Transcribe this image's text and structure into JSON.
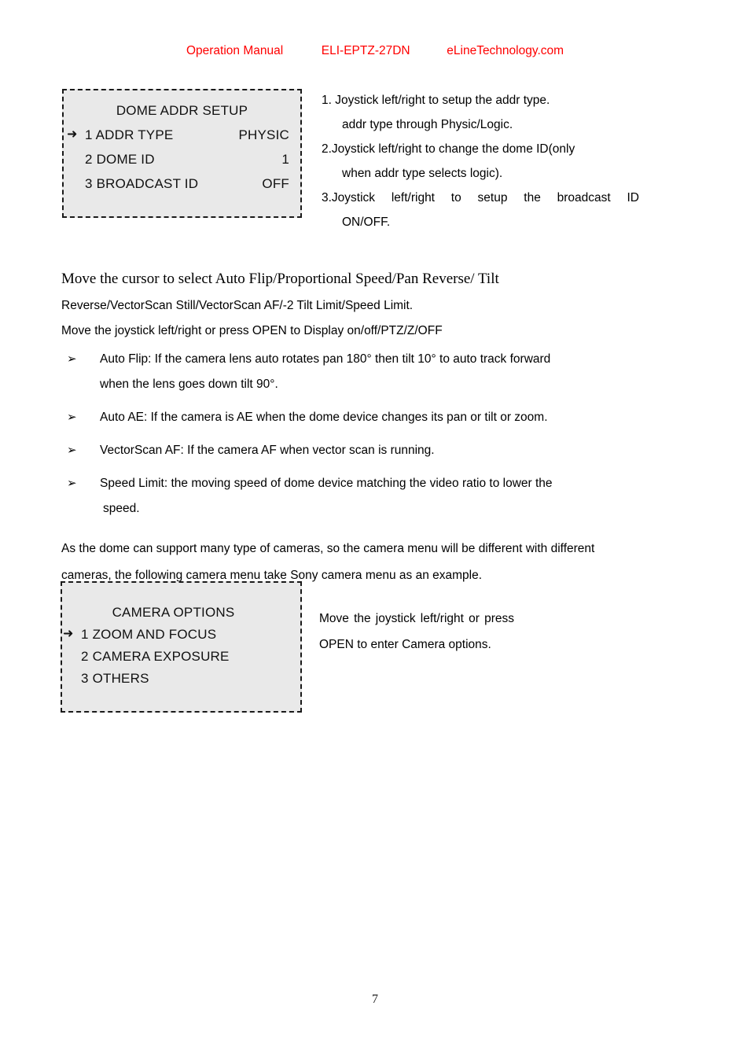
{
  "header": {
    "manual_label": "Operation Manual",
    "model": "ELI-EPTZ-27DN",
    "site": "eLineTechnology.com",
    "color": "#ff0000"
  },
  "osd_menus": [
    {
      "title": "DOME ADDR SETUP",
      "cursor_icon": "right-arrow-icon",
      "cursor_glyph": "➜",
      "rows": [
        {
          "label": "1 ADDR TYPE",
          "value": "PHYSIC",
          "selected": true
        },
        {
          "label": "2 DOME ID",
          "value": "1",
          "selected": false
        },
        {
          "label": "3 BROADCAST ID",
          "value": "OFF",
          "selected": false
        }
      ]
    },
    {
      "title": "CAMERA OPTIONS",
      "cursor_icon": "right-arrow-icon",
      "cursor_glyph": "➜",
      "rows": [
        {
          "label": "1 ZOOM AND FOCUS",
          "value": "",
          "selected": true
        },
        {
          "label": "2 CAMERA EXPOSURE",
          "value": "",
          "selected": false
        },
        {
          "label": "3 OTHERS",
          "value": "",
          "selected": false
        }
      ]
    }
  ],
  "notes_addr": {
    "line1": "1. Joystick left/right to setup the addr type.",
    "line2": "addr type through Physic/Logic.",
    "line3": "2.Joystick left/right to change the dome ID(only",
    "line4": "when addr type selects logic).",
    "line5": "3.Joystick left/right to setup the broadcast ID",
    "line6": "ON/OFF."
  },
  "body": {
    "serif_line": "Move the cursor to select Auto Flip/Proportional Speed/Pan Reverse/ Tilt",
    "line2": "Reverse/VectorScan Still/VectorScan AF/-2 Tilt Limit/Speed Limit.",
    "line3": "Move the joystick left/right or press OPEN to Display on/off/PTZ/Z/OFF"
  },
  "bullets": {
    "glyph": "➢",
    "items": [
      {
        "line1": "Auto Flip: If the camera lens auto rotates pan 180° then tilt 10° to auto track forward",
        "line2": "when the lens goes down tilt 90°."
      },
      {
        "line1": "Auto AE: If the camera is AE when the dome device changes its pan or tilt or zoom.",
        "line2": ""
      },
      {
        "line1": "VectorScan AF: If the camera AF when vector scan is running.",
        "line2": ""
      },
      {
        "line1": "Speed Limit: the moving speed of dome device matching the video ratio to lower the",
        "line2": "speed."
      }
    ]
  },
  "paragraph_dome": {
    "line1": "As the dome can support many type of cameras, so the camera menu will be different with different",
    "line2": "cameras, the following camera menu take Sony camera menu as an example."
  },
  "notes_camera": {
    "line1": "Move the joystick left/right or press",
    "line2": "OPEN to enter Camera options."
  },
  "footer": {
    "page_number": "7"
  }
}
